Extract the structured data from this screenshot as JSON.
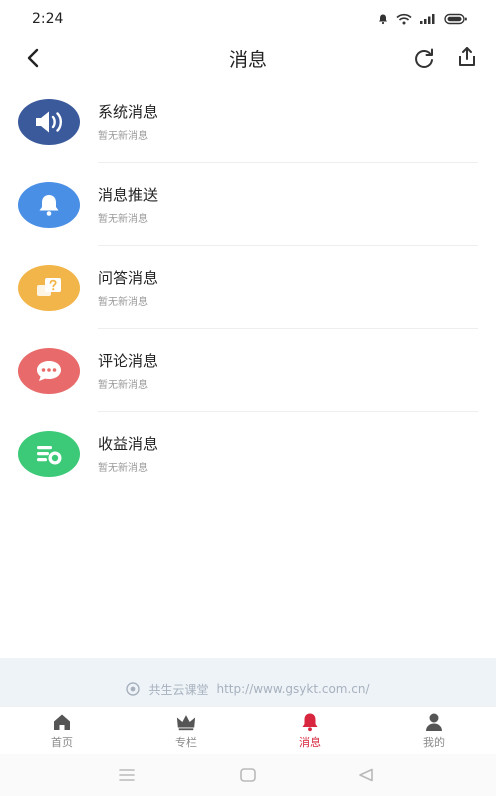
{
  "status_bar": {
    "time": "2:24",
    "icons": [
      "notification-icon",
      "wifi-icon",
      "signal-icon",
      "battery-icon"
    ]
  },
  "header": {
    "title": "消息",
    "back_icon": "chevron-left-icon",
    "actions": [
      "refresh-icon",
      "share-icon"
    ]
  },
  "messages": [
    {
      "title": "系统消息",
      "subtitle": "暂无新消息",
      "icon": "speaker-icon",
      "color": "#3b5a9c"
    },
    {
      "title": "消息推送",
      "subtitle": "暂无新消息",
      "icon": "bell-icon",
      "color": "#4a8fe6"
    },
    {
      "title": "问答消息",
      "subtitle": "暂无新消息",
      "icon": "question-card-icon",
      "color": "#f2b54a"
    },
    {
      "title": "评论消息",
      "subtitle": "暂无新消息",
      "icon": "comment-icon",
      "color": "#e96a6a"
    },
    {
      "title": "收益消息",
      "subtitle": "暂无新消息",
      "icon": "earnings-icon",
      "color": "#3dca78"
    }
  ],
  "footer": {
    "logo_icon": "logo-icon",
    "brand": "共生云课堂",
    "url": "http://www.gsykt.com.cn/"
  },
  "tab_bar": {
    "active_color": "#d7263d",
    "items": [
      {
        "label": "首页",
        "icon": "home-icon",
        "active": false
      },
      {
        "label": "专栏",
        "icon": "crown-icon",
        "active": false
      },
      {
        "label": "消息",
        "icon": "bell-icon",
        "active": true
      },
      {
        "label": "我的",
        "icon": "person-icon",
        "active": false
      }
    ]
  },
  "system_nav": [
    "menu-icon",
    "home-square-icon",
    "back-triangle-icon"
  ]
}
